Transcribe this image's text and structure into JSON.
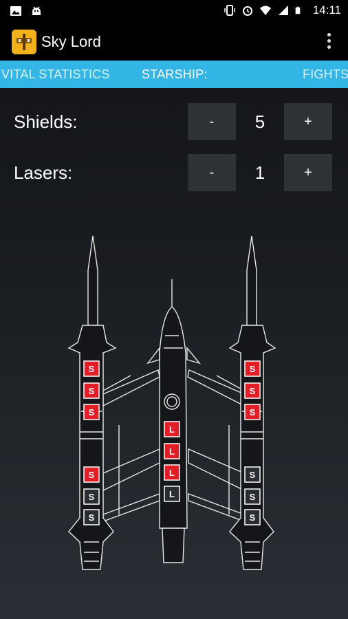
{
  "status_bar": {
    "time": "14:11",
    "left_icons": [
      "image-icon",
      "android-debug-icon"
    ],
    "right_icons": [
      "vibrate-icon",
      "alarm-icon",
      "wifi-icon",
      "signal-icon",
      "battery-icon"
    ]
  },
  "app_bar": {
    "title": "Sky Lord",
    "logo_icon": "sky-lord-logo",
    "menu_icon": "overflow-menu-icon"
  },
  "tabs": [
    {
      "label": "VITAL STATISTICS",
      "active": false
    },
    {
      "label": "STARSHIP:",
      "active": true
    },
    {
      "label": "FIGHTS",
      "active": false
    }
  ],
  "stats": {
    "shields": {
      "label": "Shields:",
      "value": "5",
      "minus": "-",
      "plus": "+"
    },
    "lasers": {
      "label": "Lasers:",
      "value": "1",
      "minus": "-",
      "plus": "+"
    }
  },
  "ship": {
    "left_pod_slots": [
      {
        "letter": "S",
        "state": "on"
      },
      {
        "letter": "S",
        "state": "on"
      },
      {
        "letter": "S",
        "state": "on"
      },
      {
        "letter": "S",
        "state": "on"
      },
      {
        "letter": "S",
        "state": "off"
      },
      {
        "letter": "S",
        "state": "off"
      }
    ],
    "center_slots": [
      {
        "letter": "L",
        "state": "on"
      },
      {
        "letter": "L",
        "state": "on"
      },
      {
        "letter": "L",
        "state": "on"
      },
      {
        "letter": "L",
        "state": "off"
      }
    ],
    "right_pod_slots": [
      {
        "letter": "S",
        "state": "on"
      },
      {
        "letter": "S",
        "state": "on"
      },
      {
        "letter": "S",
        "state": "on"
      },
      {
        "letter": "S",
        "state": "off"
      },
      {
        "letter": "S",
        "state": "off"
      },
      {
        "letter": "S",
        "state": "off"
      }
    ],
    "colors": {
      "on": "#e41e26",
      "off": "#2a2d31",
      "outline": "#e8e8e8"
    }
  }
}
